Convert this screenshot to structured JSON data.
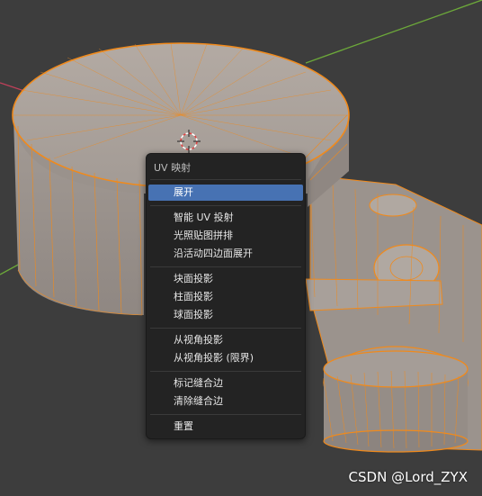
{
  "menu": {
    "title": "UV 映射",
    "items": [
      {
        "label": "展开",
        "active": true
      },
      {
        "label": "智能 UV 投射"
      },
      {
        "label": "光照贴图拼排"
      },
      {
        "label": "沿活动四边面展开"
      },
      {
        "label": "块面投影"
      },
      {
        "label": "柱面投影"
      },
      {
        "label": "球面投影"
      },
      {
        "label": "从视角投影"
      },
      {
        "label": "从视角投影 (限界)"
      },
      {
        "label": "标记缝合边"
      },
      {
        "label": "清除缝合边"
      },
      {
        "label": "重置"
      }
    ]
  },
  "watermark": "CSDN @Lord_ZYX",
  "colors": {
    "background": "#3d3d3d",
    "mesh_fill": "#a79f99",
    "wire": "#f08a1c",
    "menu_bg": "#232323",
    "highlight": "#4772b3",
    "axis_x": "#c2405a",
    "axis_y": "#6ca83a"
  }
}
